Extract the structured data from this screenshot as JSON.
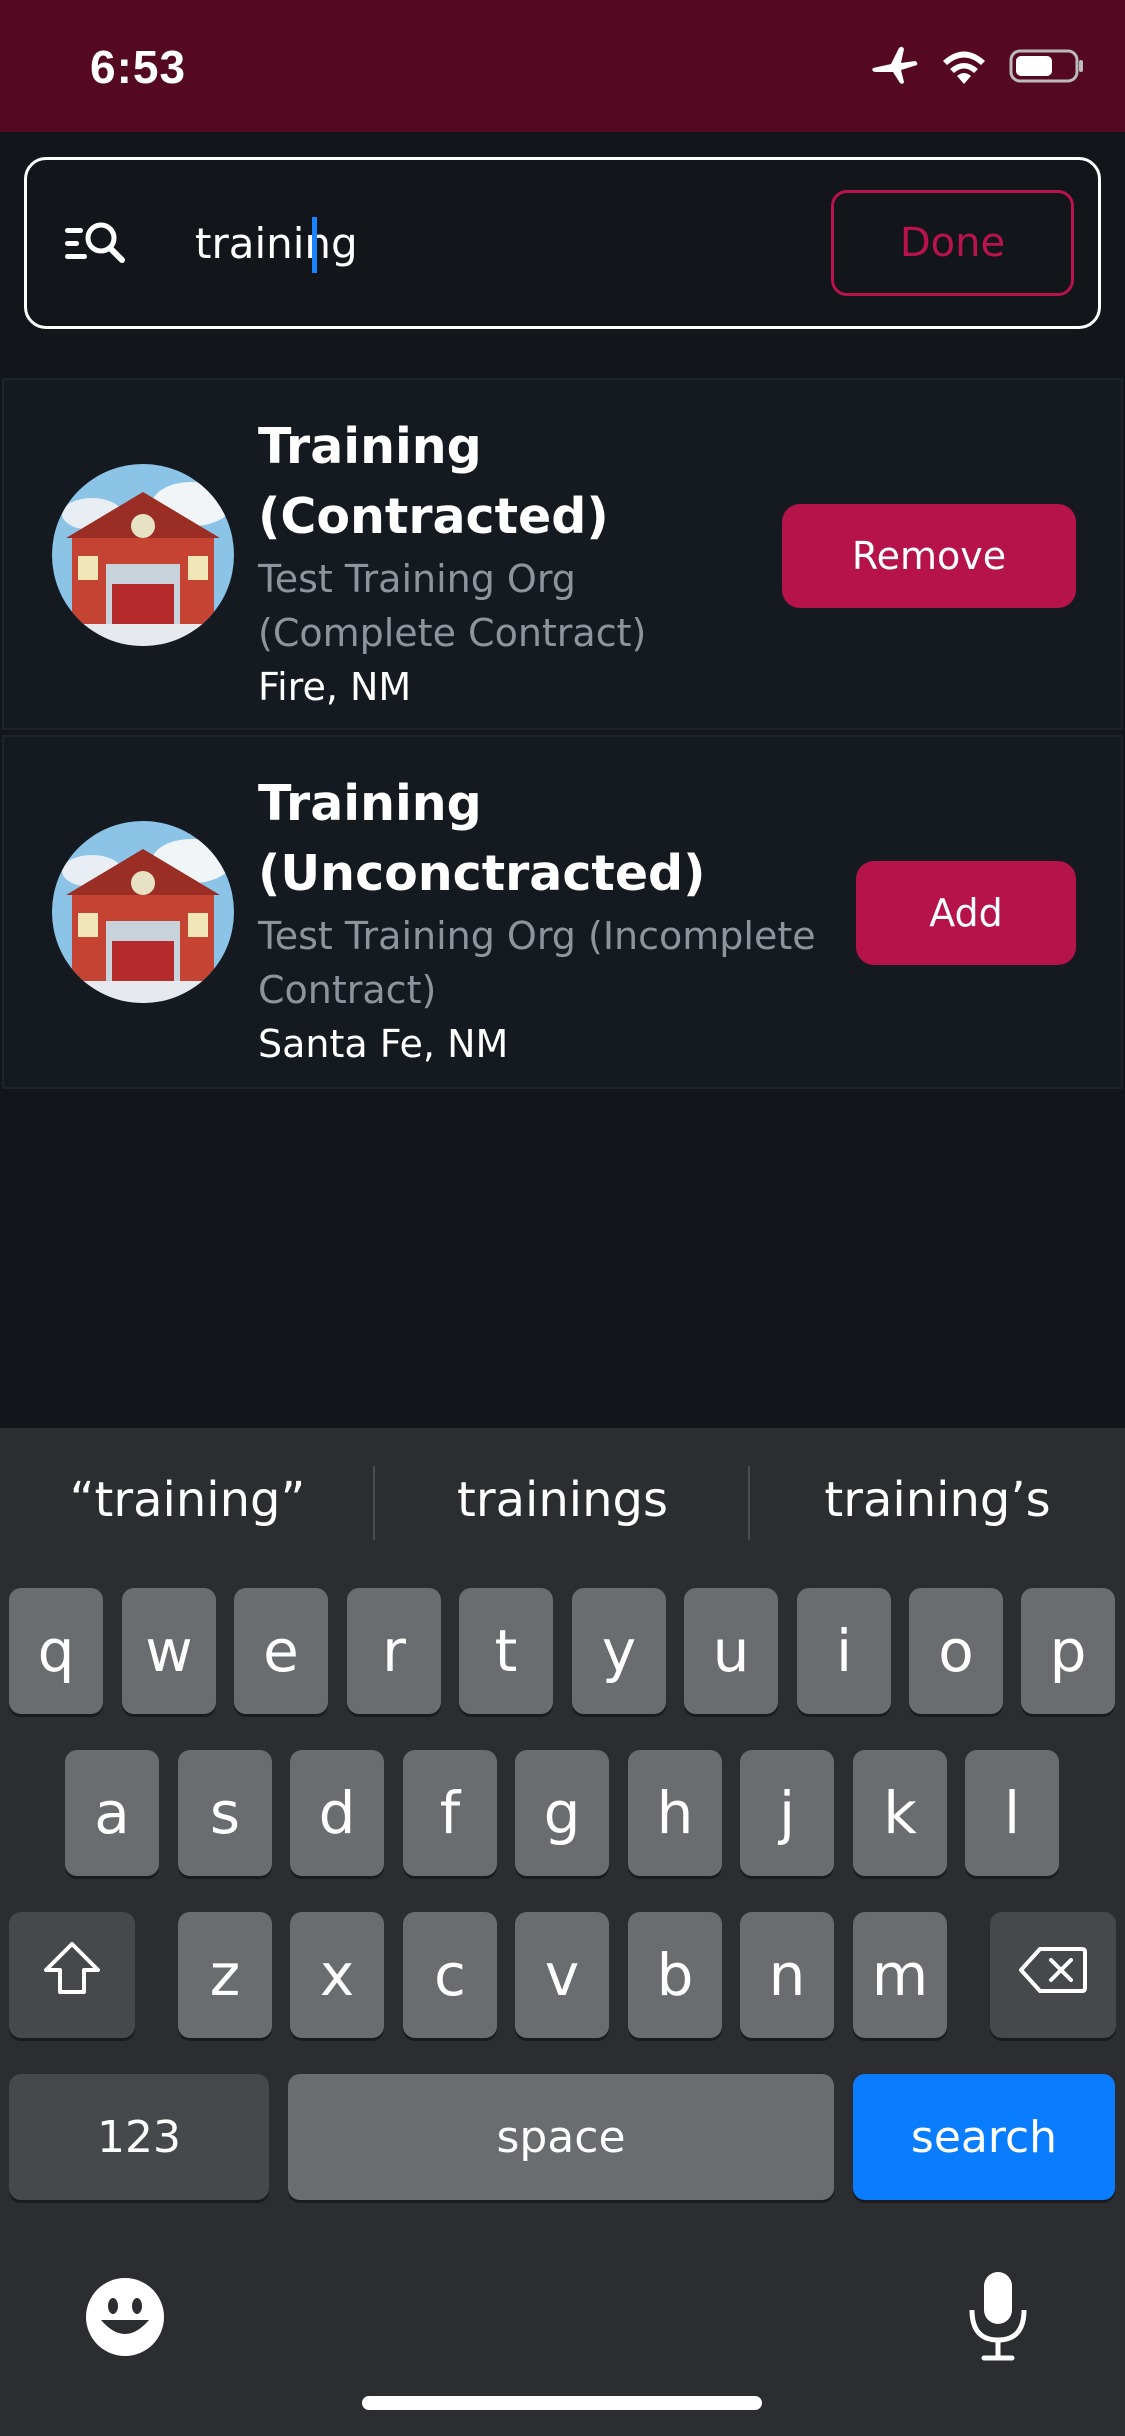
{
  "status_bar": {
    "time": "6:53",
    "battery_level": 0.65
  },
  "search": {
    "value": "training",
    "done_label": "Done"
  },
  "results": [
    {
      "title_line1": "Training",
      "title_line2": "(Contracted)",
      "sub_line1": "Test Training Org",
      "sub_line2": "(Complete Contract)",
      "location": "Fire, NM",
      "action_label": "Remove"
    },
    {
      "title_line1": "Training",
      "title_line2": "(Unconctracted)",
      "sub_line1": "Test Training Org (Incomplete",
      "sub_line2": "Contract)",
      "location": "Santa Fe, NM",
      "action_label": "Add"
    }
  ],
  "keyboard": {
    "suggestions": [
      "“training”",
      "trainings",
      "training’s"
    ],
    "row1": [
      "q",
      "w",
      "e",
      "r",
      "t",
      "y",
      "u",
      "i",
      "o",
      "p"
    ],
    "row2": [
      "a",
      "s",
      "d",
      "f",
      "g",
      "h",
      "j",
      "k",
      "l"
    ],
    "row3": [
      "z",
      "x",
      "c",
      "v",
      "b",
      "n",
      "m"
    ],
    "numbers_label": "123",
    "space_label": "space",
    "search_label": "search"
  },
  "colors": {
    "brand": "#b5134a",
    "status_bar": "#550821",
    "keyboard_search": "#0a7dff"
  }
}
